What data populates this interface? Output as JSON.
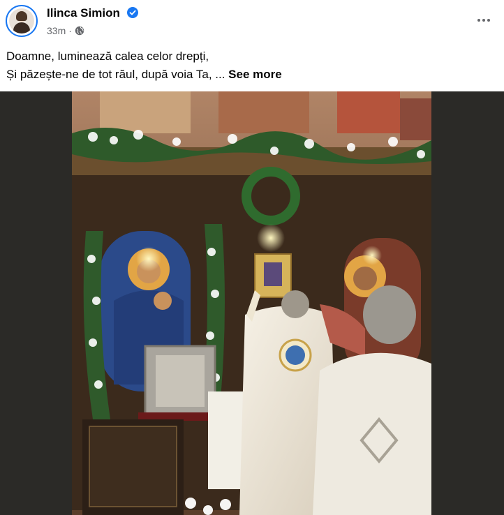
{
  "post": {
    "author": "Ilinca Simion",
    "time": "33m",
    "caption_line1": "Doamne, luminează calea celor drepți,",
    "caption_line2": "Și păzește-ne de tot răul, după voia Ta, ...",
    "see_more": "See more"
  },
  "icons": {
    "verified": "verified-badge-icon",
    "audience": "globe-icon",
    "more": "more-options-icon"
  },
  "colors": {
    "verified": "#1877f2",
    "secondary_text": "#65676b",
    "photo_background": "#2b2a27"
  }
}
